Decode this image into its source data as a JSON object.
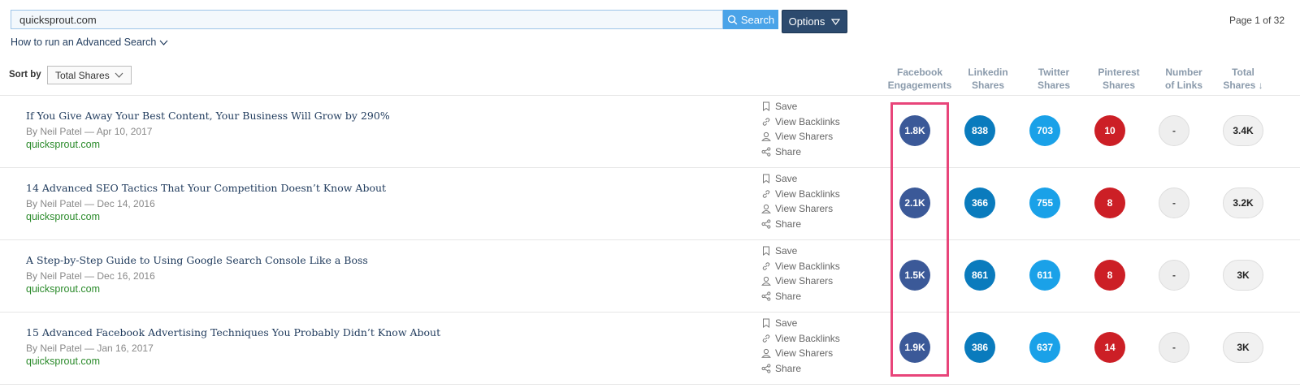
{
  "search": {
    "value": "quicksprout.com",
    "button_label": "Search",
    "options_label": "Options"
  },
  "pagination": {
    "label": "Page 1 of 32"
  },
  "advanced_link": "How to run an Advanced Search",
  "sort": {
    "label": "Sort by",
    "selected": "Total Shares"
  },
  "columns": [
    {
      "line1": "Facebook",
      "line2": "Engagements"
    },
    {
      "line1": "Linkedin",
      "line2": "Shares"
    },
    {
      "line1": "Twitter",
      "line2": "Shares"
    },
    {
      "line1": "Pinterest",
      "line2": "Shares"
    },
    {
      "line1": "Number",
      "line2": "of Links"
    },
    {
      "line1": "Total",
      "line2": "Shares ↓"
    }
  ],
  "actions": {
    "save": "Save",
    "backlinks": "View Backlinks",
    "sharers": "View Sharers",
    "share": "Share"
  },
  "rows": [
    {
      "title": "If You Give Away Your Best Content, Your Business Will Grow by 290%",
      "byline": "By Neil Patel — Apr 10, 2017",
      "domain": "quicksprout.com",
      "facebook": "1.8K",
      "linkedin": "838",
      "twitter": "703",
      "pinterest": "10",
      "links": "-",
      "total": "3.4K"
    },
    {
      "title": "14 Advanced SEO Tactics That Your Competition Doesn’t Know About",
      "byline": "By Neil Patel — Dec 14, 2016",
      "domain": "quicksprout.com",
      "facebook": "2.1K",
      "linkedin": "366",
      "twitter": "755",
      "pinterest": "8",
      "links": "-",
      "total": "3.2K"
    },
    {
      "title": "A Step-by-Step Guide to Using Google Search Console Like a Boss",
      "byline": "By Neil Patel — Dec 16, 2016",
      "domain": "quicksprout.com",
      "facebook": "1.5K",
      "linkedin": "861",
      "twitter": "611",
      "pinterest": "8",
      "links": "-",
      "total": "3K"
    },
    {
      "title": "15 Advanced Facebook Advertising Techniques You Probably Didn’t Know About",
      "byline": "By Neil Patel — Jan 16, 2017",
      "domain": "quicksprout.com",
      "facebook": "1.9K",
      "linkedin": "386",
      "twitter": "637",
      "pinterest": "14",
      "links": "-",
      "total": "3K"
    }
  ],
  "colors": {
    "facebook": "#3b5998",
    "linkedin": "#0a7bbd",
    "twitter": "#1aa1e8",
    "pinterest": "#cc1f26",
    "highlight": "#e8457a",
    "search_button": "#4aa3e8",
    "options_button": "#2c4a6e"
  }
}
